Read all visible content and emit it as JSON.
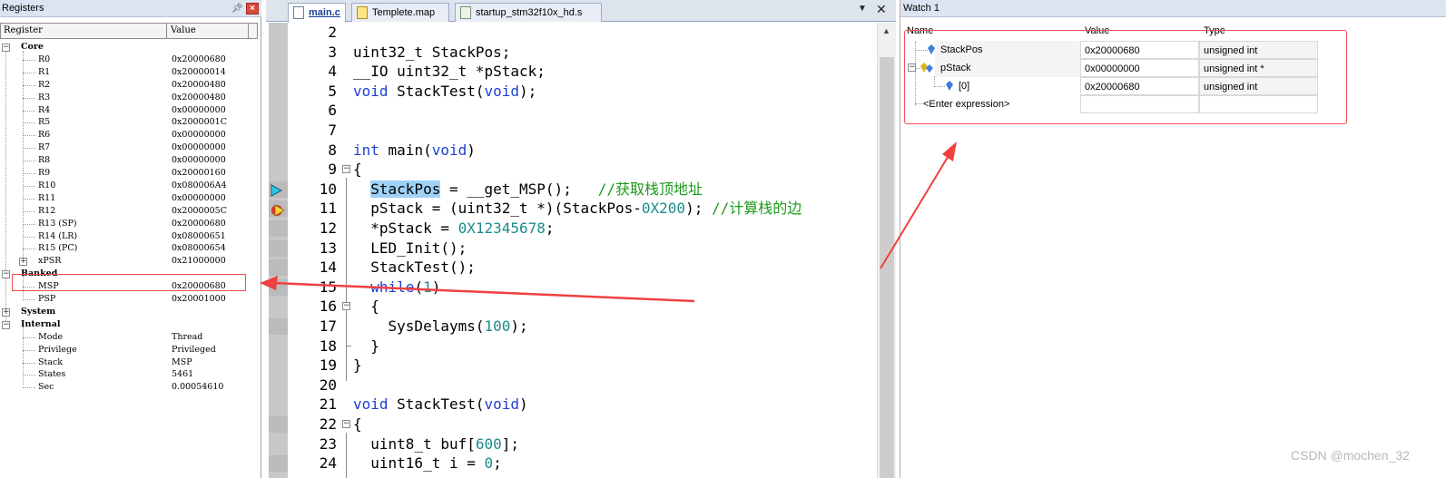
{
  "registers": {
    "title": "Registers",
    "headers": [
      "Register",
      "Value"
    ],
    "groups": {
      "core": "Core",
      "banked": "Banked",
      "system": "System",
      "internal": "Internal"
    },
    "core": [
      {
        "name": "R0",
        "value": "0x20000680"
      },
      {
        "name": "R1",
        "value": "0x20000014"
      },
      {
        "name": "R2",
        "value": "0x20000480"
      },
      {
        "name": "R3",
        "value": "0x20000480"
      },
      {
        "name": "R4",
        "value": "0x00000000"
      },
      {
        "name": "R5",
        "value": "0x2000001C"
      },
      {
        "name": "R6",
        "value": "0x00000000"
      },
      {
        "name": "R7",
        "value": "0x00000000"
      },
      {
        "name": "R8",
        "value": "0x00000000"
      },
      {
        "name": "R9",
        "value": "0x20000160"
      },
      {
        "name": "R10",
        "value": "0x080006A4"
      },
      {
        "name": "R11",
        "value": "0x00000000"
      },
      {
        "name": "R12",
        "value": "0x2000005C"
      },
      {
        "name": "R13 (SP)",
        "value": "0x20000680"
      },
      {
        "name": "R14 (LR)",
        "value": "0x08000651"
      },
      {
        "name": "R15 (PC)",
        "value": "0x08000654"
      },
      {
        "name": "xPSR",
        "value": "0x21000000"
      }
    ],
    "banked": [
      {
        "name": "MSP",
        "value": "0x20000680"
      },
      {
        "name": "PSP",
        "value": "0x20001000"
      }
    ],
    "internal": [
      {
        "name": "Mode",
        "value": "Thread"
      },
      {
        "name": "Privilege",
        "value": "Privileged"
      },
      {
        "name": "Stack",
        "value": "MSP"
      },
      {
        "name": "States",
        "value": "5461"
      },
      {
        "name": "Sec",
        "value": "0.00054610"
      }
    ]
  },
  "editor": {
    "tabs": [
      {
        "label": "main.c",
        "active": true
      },
      {
        "label": "Templete.map",
        "active": false
      },
      {
        "label": "startup_stm32f10x_hd.s",
        "active": false
      }
    ],
    "lines": [
      {
        "n": "2",
        "t": ""
      },
      {
        "n": "3",
        "t": "uint32_t StackPos;"
      },
      {
        "n": "4",
        "t": "__IO uint32_t *pStack;"
      },
      {
        "n": "5",
        "t": "void StackTest(void);"
      },
      {
        "n": "6",
        "t": ""
      },
      {
        "n": "7",
        "t": ""
      },
      {
        "n": "8",
        "t": "int main(void)"
      },
      {
        "n": "9",
        "t": "{"
      },
      {
        "n": "10",
        "t": "  StackPos = __get_MSP();   //获取栈顶地址"
      },
      {
        "n": "11",
        "t": "  pStack = (uint32_t *)(StackPos-0X200); //计算栈的边"
      },
      {
        "n": "12",
        "t": "  *pStack = 0X12345678;"
      },
      {
        "n": "13",
        "t": "  LED_Init();"
      },
      {
        "n": "14",
        "t": "  StackTest();"
      },
      {
        "n": "15",
        "t": "  while(1)"
      },
      {
        "n": "16",
        "t": "  {"
      },
      {
        "n": "17",
        "t": "    SysDelayms(100);"
      },
      {
        "n": "18",
        "t": "  }"
      },
      {
        "n": "19",
        "t": "}"
      },
      {
        "n": "20",
        "t": ""
      },
      {
        "n": "21",
        "t": "void StackTest(void)"
      },
      {
        "n": "22",
        "t": "{"
      },
      {
        "n": "23",
        "t": "  uint8_t buf[600];"
      },
      {
        "n": "24",
        "t": "  uint16_t i = 0;"
      }
    ]
  },
  "watch": {
    "title": "Watch 1",
    "columns": [
      "Name",
      "Value",
      "Type"
    ],
    "rows": [
      {
        "name": "StackPos",
        "value": "0x20000680",
        "type": "unsigned int"
      },
      {
        "name": "pStack",
        "value": "0x00000000",
        "type": "unsigned int *"
      },
      {
        "name": "[0]",
        "value": "0x20000680",
        "type": "unsigned int"
      }
    ],
    "enter_expression": "<Enter expression>"
  },
  "watermark": "CSDN @mochen_32",
  "colors": {
    "annotation": "#f05050",
    "keyword": "#1e3fd0",
    "comment": "#1c9a1c",
    "number": "#1a8b8b",
    "selection": "#9fd1f7"
  }
}
